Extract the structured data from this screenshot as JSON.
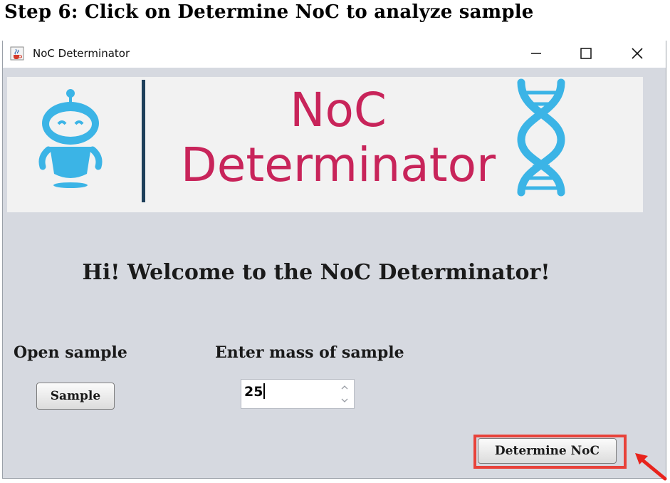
{
  "step_heading": "Step 6: Click on Determine NoC to analyze sample",
  "window": {
    "title": "NoC Determinator",
    "icon": "java-cup-icon",
    "controls": [
      "minimize-icon",
      "maximize-icon",
      "close-icon"
    ]
  },
  "banner": {
    "line1": "NoC",
    "line2": "Determinator",
    "logo_icon": "robot-icon",
    "dna_icon": "dna-helix-icon",
    "colors": {
      "text": "#c8245a",
      "robot": "#3bb4e6",
      "divider": "#1e3f5a",
      "dna": "#3bb4e6"
    }
  },
  "welcome": "Hi! Welcome to the NoC Determinator!",
  "open_sample": {
    "label": "Open sample",
    "button": "Sample"
  },
  "mass": {
    "label": "Enter mass of sample",
    "value": "25"
  },
  "determine_button": "Determine NoC",
  "annotation": {
    "highlight_color": "#e8423a",
    "arrow_icon": "red-arrow-icon"
  }
}
